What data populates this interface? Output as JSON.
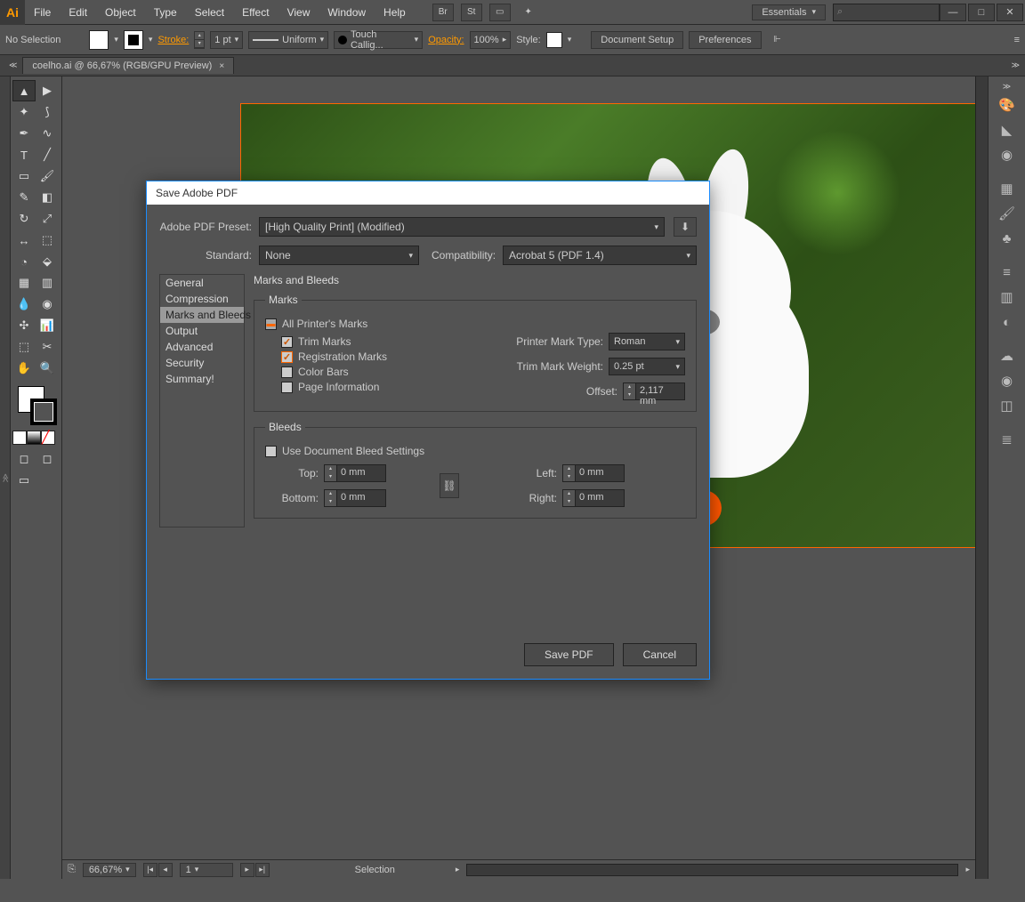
{
  "app": {
    "icon": "Ai"
  },
  "menu": [
    "File",
    "Edit",
    "Object",
    "Type",
    "Select",
    "Effect",
    "View",
    "Window",
    "Help"
  ],
  "titlebar": {
    "workspace": "Essentials",
    "search_placeholder": ""
  },
  "controlbar": {
    "selection": "No Selection",
    "stroke_label": "Stroke:",
    "stroke_val": "1 pt",
    "uniform": "Uniform",
    "brush": "Touch Callig...",
    "opacity_label": "Opacity:",
    "opacity_val": "100%",
    "style_label": "Style:",
    "doc_setup": "Document Setup",
    "prefs": "Preferences"
  },
  "tab": {
    "label": "coelho.ai @ 66,67% (RGB/GPU Preview)"
  },
  "statusbar": {
    "zoom": "66,67%",
    "page": "1",
    "tool": "Selection"
  },
  "dialog": {
    "title": "Save Adobe PDF",
    "preset_label": "Adobe PDF Preset:",
    "preset": "[High Quality Print] (Modified)",
    "standard_label": "Standard:",
    "standard": "None",
    "compat_label": "Compatibility:",
    "compat": "Acrobat 5 (PDF 1.4)",
    "sidebar": [
      "General",
      "Compression",
      "Marks and Bleeds",
      "Output",
      "Advanced",
      "Security",
      "Summary!"
    ],
    "section_title": "Marks and Bleeds",
    "marks": {
      "legend": "Marks",
      "all": "All Printer's Marks",
      "trim": "Trim Marks",
      "reg": "Registration Marks",
      "colorbars": "Color Bars",
      "pageinfo": "Page Information",
      "type_label": "Printer Mark Type:",
      "type": "Roman",
      "weight_label": "Trim Mark Weight:",
      "weight": "0.25 pt",
      "offset_label": "Offset:",
      "offset": "2,117 mm"
    },
    "bleeds": {
      "legend": "Bleeds",
      "usedoc": "Use Document Bleed Settings",
      "top_label": "Top:",
      "top": "0 mm",
      "bottom_label": "Bottom:",
      "bottom": "0 mm",
      "left_label": "Left:",
      "left": "0 mm",
      "right_label": "Right:",
      "right": "0 mm"
    },
    "save_btn": "Save PDF",
    "cancel_btn": "Cancel"
  }
}
